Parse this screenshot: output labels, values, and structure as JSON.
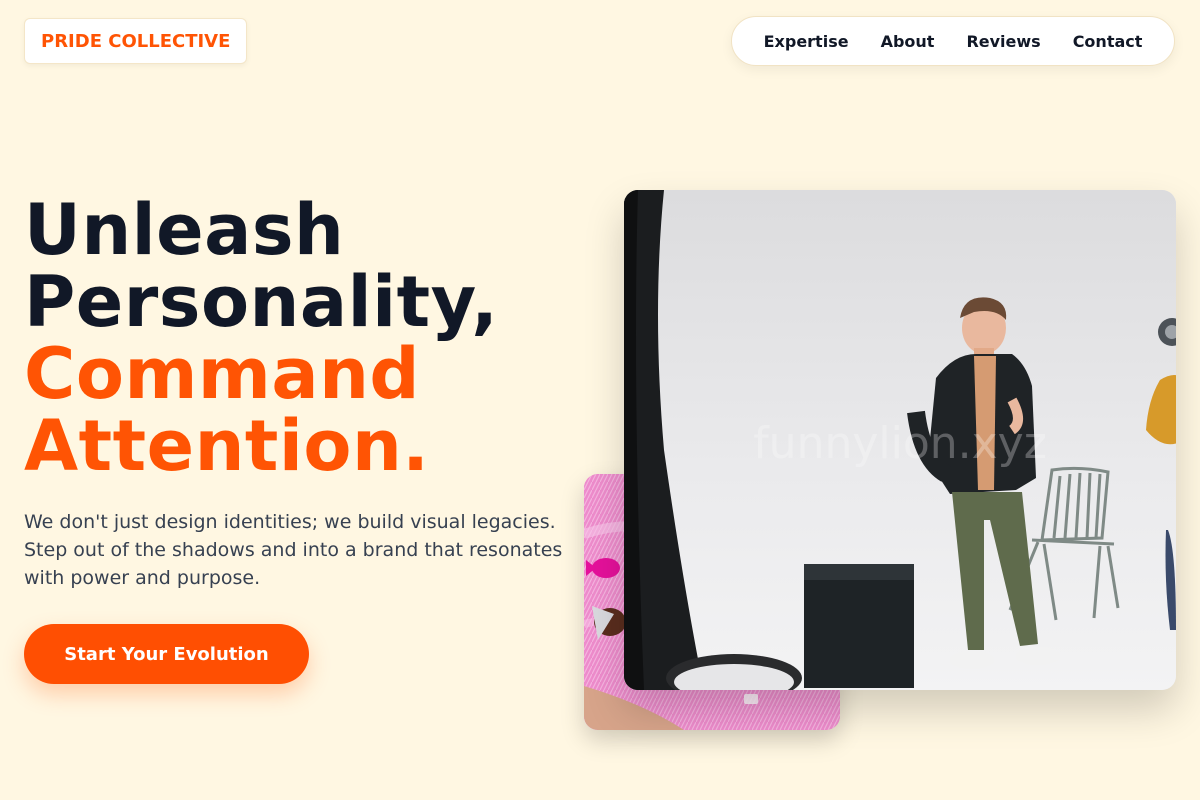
{
  "brand": {
    "name": "PRIDE COLLECTIVE"
  },
  "nav": {
    "items": [
      "Expertise",
      "About",
      "Reviews",
      "Contact"
    ]
  },
  "hero": {
    "line1": "Unleash",
    "line2": "Personality,",
    "line3": "Command",
    "line4": "Attention.",
    "body": "We don't just design identities; we build visual legacies. Step out of the shadows and into a brand that resonates with power and purpose.",
    "cta": "Start Your Evolution"
  },
  "images": {
    "main_alt": "Man in dark blazer posing in a white photo studio with a chair and black box",
    "secondary_alt": "Hand reaching into pink fur with wrapped chocolate candies",
    "watermark": "funnylion.xyz"
  },
  "colors": {
    "accent": "#ff5404",
    "ink": "#111827",
    "background": "#fff7e2"
  }
}
